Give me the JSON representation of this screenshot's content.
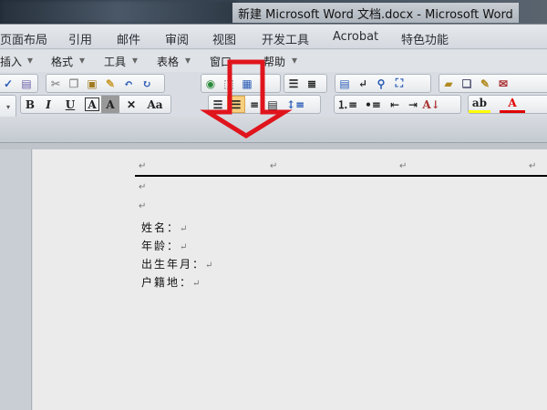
{
  "window": {
    "title": "新建 Microsoft Word 文档.docx - Microsoft Word"
  },
  "ribbon_tabs": [
    "页面布局",
    "引用",
    "邮件",
    "审阅",
    "视图",
    "开发工具",
    "Acrobat",
    "特色功能"
  ],
  "menu": [
    "插入",
    "格式",
    "工具",
    "表格",
    "窗口",
    "帮助"
  ],
  "toolbar": {
    "bold": "B",
    "italic": "I",
    "underline": "U",
    "char_border": "A",
    "char_shading": "A",
    "change_case": "Aa",
    "font_color": "A"
  },
  "document": {
    "paragraph_mark": "↵",
    "lines": [
      "姓名：",
      "年龄：",
      "出生年月：",
      "户籍地："
    ]
  },
  "colors": {
    "arrow": "#e0141c",
    "highlight": "#ffff00",
    "font_color": "#e00000"
  }
}
